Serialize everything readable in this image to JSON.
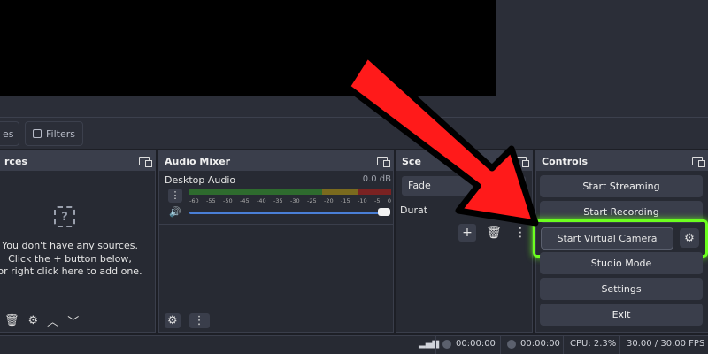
{
  "toolbar": {
    "scenes_tab_label": "es",
    "filters_tab_label": "Filters"
  },
  "sources": {
    "title": "rces",
    "empty_message_line1": "You don't have any sources.",
    "empty_message_line2": "Click the + button below,",
    "empty_message_line3": "or right click here to add one."
  },
  "audio_mixer": {
    "title": "Audio Mixer",
    "channel_name": "Desktop Audio",
    "channel_db": "0.0 dB",
    "scale_ticks": [
      "-60",
      "-55",
      "-50",
      "-45",
      "-40",
      "-35",
      "-30",
      "-25",
      "-20",
      "-15",
      "-10",
      "-5",
      "0"
    ],
    "meter_colors": {
      "green": "#38a838",
      "yellow": "#c0a020",
      "red": "#c03030"
    }
  },
  "transitions": {
    "title": "Sce",
    "selected": "Fade",
    "duration_label": "Durat"
  },
  "controls": {
    "title": "Controls",
    "start_streaming": "Start Streaming",
    "start_recording": "Start Recording",
    "start_virtual_camera": "Start Virtual Camera",
    "studio_mode": "Studio Mode",
    "settings": "Settings",
    "exit": "Exit"
  },
  "statusbar": {
    "stream_time": "00:00:00",
    "record_time": "00:00:00",
    "cpu": "CPU: 2.3%",
    "fps": "30.00 / 30.00 FPS"
  },
  "accents": {
    "highlight": "#6cff1f",
    "arrow": "#ff1a1a",
    "volume": "#4a7fd6"
  }
}
